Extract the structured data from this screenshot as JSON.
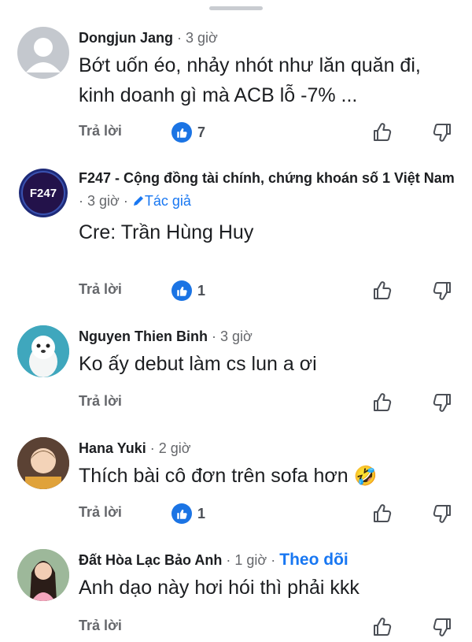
{
  "comments": [
    {
      "name": "Dongjun Jang",
      "time": "3 giờ",
      "text": "Bớt uốn éo, nhảy nhót như lăn quăn đi, kinh doanh gì mà ACB lỗ -7% ...",
      "reply_label": "Trả lời",
      "like_count": "7"
    },
    {
      "name": "F247 - Cộng đồng tài chính, chứng khoán số 1 Việt Nam",
      "time": "3 giờ",
      "author_label": "Tác giả",
      "avatar_logo_text": "F247",
      "text": "Cre: Trần Hùng Huy",
      "reply_label": "Trả lời",
      "like_count": "1"
    },
    {
      "name": "Nguyen Thien Binh",
      "time": "3 giờ",
      "text": "Ko ấy debut làm cs lun a ơi",
      "reply_label": "Trả lời"
    },
    {
      "name": "Hana Yuki",
      "time": "2 giờ",
      "text": "Thích bài cô đơn trên sofa hơn",
      "emoji": "🤣",
      "reply_label": "Trả lời",
      "like_count": "1"
    },
    {
      "name": "Đất Hòa Lạc Bảo Anh",
      "time": "1 giờ",
      "follow_label": "Theo dõi",
      "text": "Anh dạo này hơi hói thì phải kkk",
      "reply_label": "Trả lời"
    }
  ],
  "separator": "·",
  "icons": [
    "like-badge-icon",
    "thumbs-up-icon",
    "thumbs-down-icon",
    "pencil-icon",
    "default-avatar-icon"
  ],
  "colors": {
    "accent": "#1877f2",
    "muted": "#65676b",
    "text": "#1c1e21"
  }
}
